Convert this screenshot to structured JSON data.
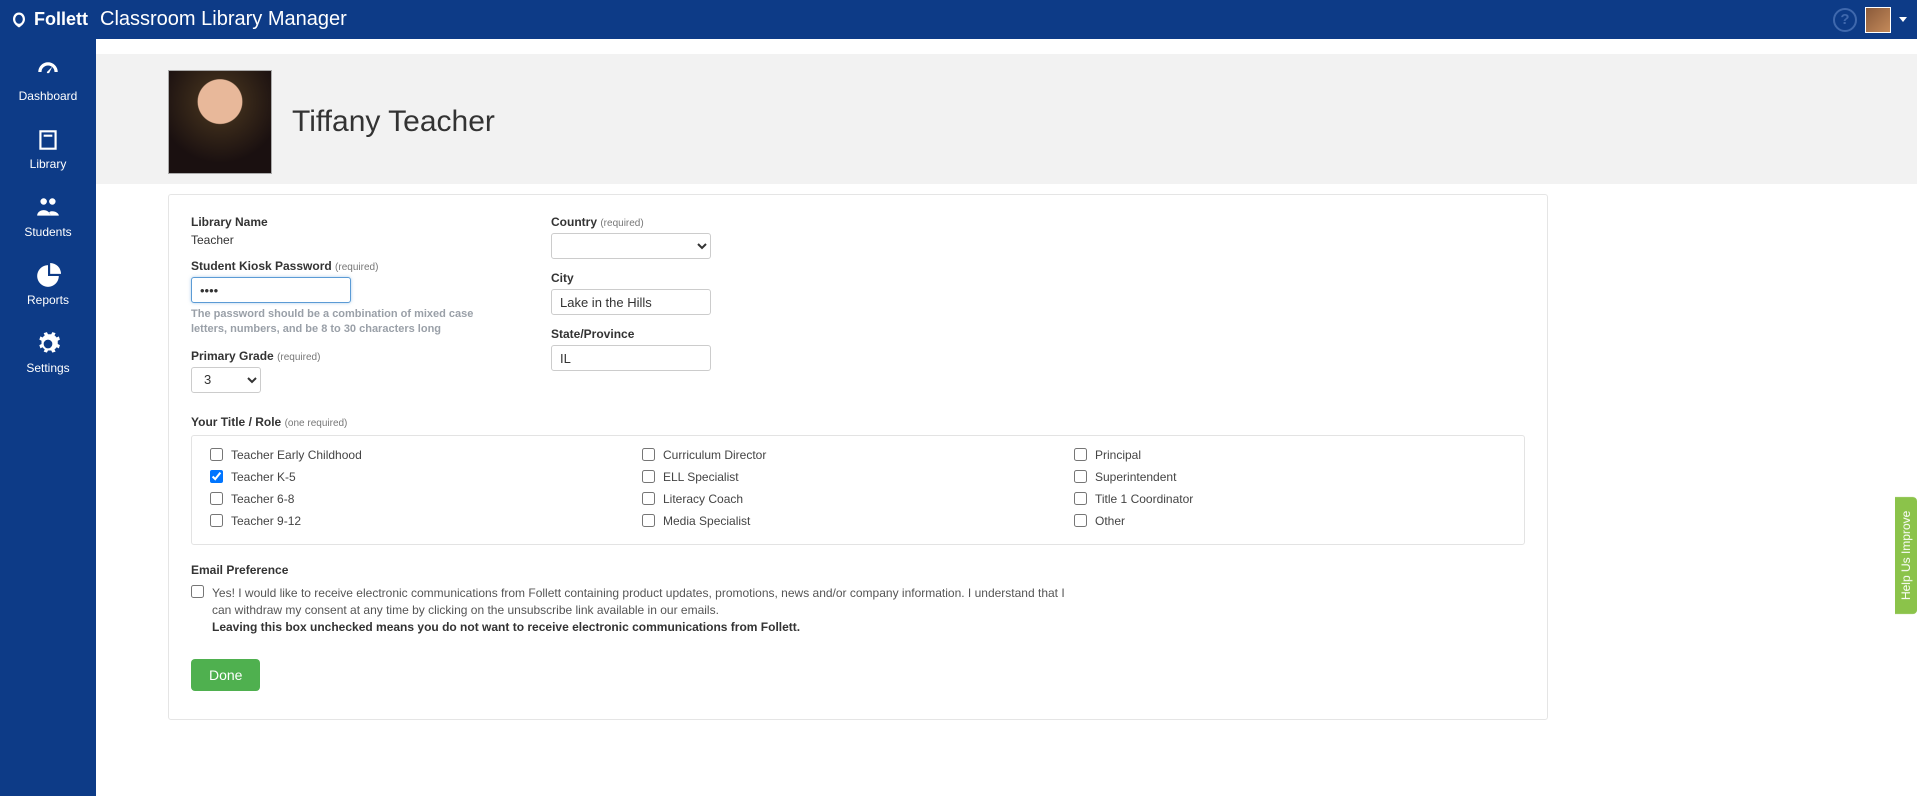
{
  "app": {
    "brand": "Follett",
    "title": "Classroom Library Manager"
  },
  "sidebar": {
    "items": [
      {
        "label": "Dashboard"
      },
      {
        "label": "Library"
      },
      {
        "label": "Students"
      },
      {
        "label": "Reports"
      },
      {
        "label": "Settings"
      }
    ]
  },
  "profile": {
    "name": "Tiffany Teacher"
  },
  "form": {
    "library_name_label": "Library Name",
    "library_name_value": "Teacher",
    "kiosk_pw_label": "Student Kiosk Password",
    "required_text": "(required)",
    "one_required_text": "(one required)",
    "kiosk_pw_value": "••••",
    "kiosk_hint": "The password should be a combination of mixed case letters, numbers, and be 8 to 30 characters long",
    "primary_grade_label": "Primary Grade",
    "primary_grade_value": "3",
    "country_label": "Country",
    "country_value": "",
    "city_label": "City",
    "city_value": "Lake in the Hills",
    "state_label": "State/Province",
    "state_value": "IL",
    "role_section_label": "Your Title / Role",
    "roles": {
      "col1": [
        {
          "label": "Teacher Early Childhood",
          "checked": false
        },
        {
          "label": "Teacher K-5",
          "checked": true
        },
        {
          "label": "Teacher 6-8",
          "checked": false
        },
        {
          "label": "Teacher 9-12",
          "checked": false
        }
      ],
      "col2": [
        {
          "label": "Curriculum Director",
          "checked": false
        },
        {
          "label": "ELL Specialist",
          "checked": false
        },
        {
          "label": "Literacy Coach",
          "checked": false
        },
        {
          "label": "Media Specialist",
          "checked": false
        }
      ],
      "col3": [
        {
          "label": "Principal",
          "checked": false
        },
        {
          "label": "Superintendent",
          "checked": false
        },
        {
          "label": "Title 1 Coordinator",
          "checked": false
        },
        {
          "label": "Other",
          "checked": false
        }
      ]
    },
    "email_pref_label": "Email Preference",
    "email_pref_text": "Yes! I would like to receive electronic communications from Follett containing product updates, promotions, news and/or company information. I understand that I can withdraw my consent at any time by clicking on the unsubscribe link available in our emails.",
    "email_pref_bold": "Leaving this box unchecked means you do not want to receive electronic communications from Follett.",
    "done_label": "Done"
  },
  "feedback_tab": "Help Us Improve"
}
